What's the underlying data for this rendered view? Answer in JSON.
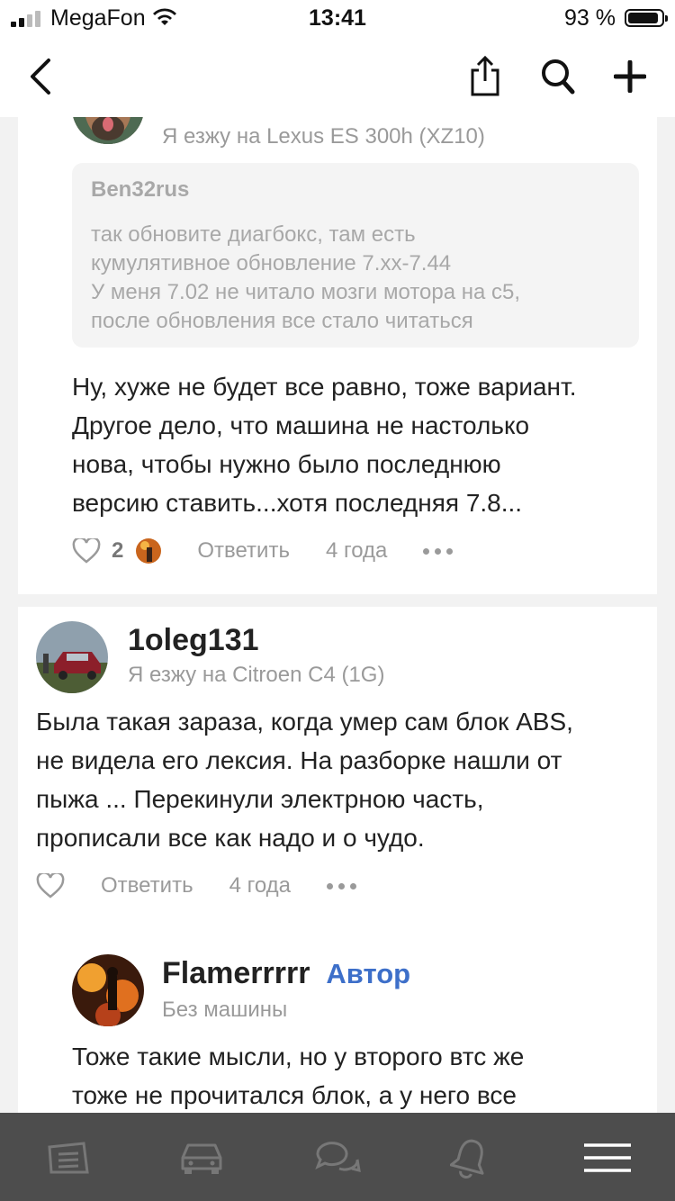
{
  "status_bar": {
    "carrier": "MegaFon",
    "time": "13:41",
    "battery": "93 %",
    "battery_level": 0.93
  },
  "header": {
    "back_icon": "chevron-left-icon",
    "share_icon": "share-icon",
    "search_icon": "search-icon",
    "add_icon": "plus-icon"
  },
  "comments": [
    {
      "subtitle": "Я езжу на Lexus ES 300h (XZ10)",
      "quote": {
        "author": "Ben32rus",
        "lines": [
          "так обновите диагбокс, там есть",
          "кумулятивное обновление 7.xx-7.44",
          "У меня 7.02 не читало мозги мотора на с5,",
          "после обновления все стало читаться"
        ]
      },
      "lines": [
        "Ну, хуже не будет все равно, тоже вариант.",
        "Другое дело, что машина не настолько",
        "нова, чтобы нужно было последнюю",
        "версию ставить...хотя последняя 7.8..."
      ],
      "likes": "2",
      "reply": "Ответить",
      "time": "4 года"
    },
    {
      "username": "1oleg131",
      "subtitle": "Я езжу на Citroen C4 (1G)",
      "lines": [
        "Была такая зараза, когда умер сам блок ABS,",
        "не видела его лексия. На разборке нашли от",
        "пыжа ... Перекинули электрною часть,",
        "прописали все как надо и о чудо."
      ],
      "reply": "Ответить",
      "time": "4 года"
    },
    {
      "username": "Flamerrrrr",
      "badge": "Автор",
      "subtitle": "Без машины",
      "lines": [
        "Тоже такие мысли, но у второго втс же",
        "тоже не прочитался блок, а у него все"
      ]
    }
  ],
  "colors": {
    "accent": "#3d6fc9",
    "tabbar": "#4d4d4d",
    "muted": "#9a9a9a"
  },
  "tabbar": [
    "feed-icon",
    "car-icon",
    "chat-icon",
    "bell-icon",
    "menu-icon"
  ]
}
